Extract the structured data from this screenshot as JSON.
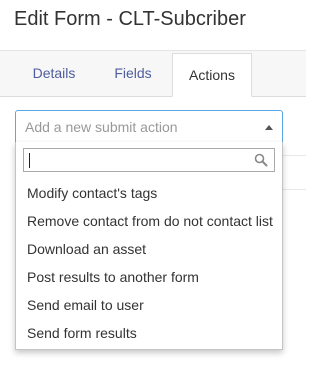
{
  "header": {
    "title": "Edit Form - CLT-Subcriber"
  },
  "tabs": [
    {
      "label": "Details",
      "active": false
    },
    {
      "label": "Fields",
      "active": false
    },
    {
      "label": "Actions",
      "active": true
    }
  ],
  "action_select": {
    "placeholder": "Add a new submit action",
    "search_value": "",
    "options": [
      {
        "label": "Modify contact's tags"
      },
      {
        "label": "Remove contact from do not contact list"
      },
      {
        "label": "Download an asset"
      },
      {
        "label": "Post results to another form"
      },
      {
        "label": "Send email to user"
      },
      {
        "label": "Send form results"
      }
    ]
  },
  "icons": {
    "search": "search-icon",
    "arrow": "chevron-up-icon"
  },
  "colors": {
    "tab_link": "#4e5d9d",
    "select_focus_border": "#5aa7e5",
    "text": "#333333",
    "placeholder": "#999999"
  }
}
